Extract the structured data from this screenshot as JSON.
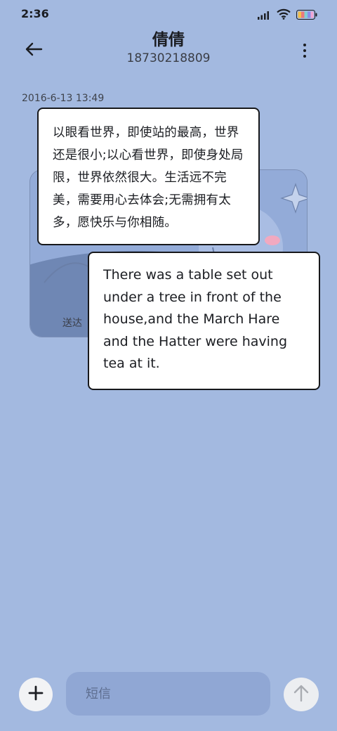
{
  "status_bar": {
    "time": "2:36",
    "icons": [
      "signal-icon",
      "wifi-icon",
      "battery-icon"
    ]
  },
  "header": {
    "contact_name": "倩倩",
    "contact_number": "18730218809",
    "back_icon": "arrow-left-icon",
    "menu_icon": "more-vertical-icon"
  },
  "conversation": {
    "timestamp": "2016-6-13 13:49",
    "image_message": {
      "status_text": "送达"
    },
    "overlay_text_cn": "以眼看世界，即使站的最高，世界还是很小;以心看世界，即使身处局限，世界依然很大。生活远不完美，需要用心去体会;无需拥有太多，愿快乐与你相随。",
    "overlay_text_en": "There was a table set out under a tree in front of the house,and the March Hare and the Hatter were having tea at it."
  },
  "compose": {
    "placeholder": "短信",
    "add_icon": "plus-icon",
    "send_icon": "arrow-up-icon"
  },
  "colors": {
    "background": "#a3b9e0",
    "input_background": "#90a7d4",
    "bubble_background": "#ffffff"
  }
}
